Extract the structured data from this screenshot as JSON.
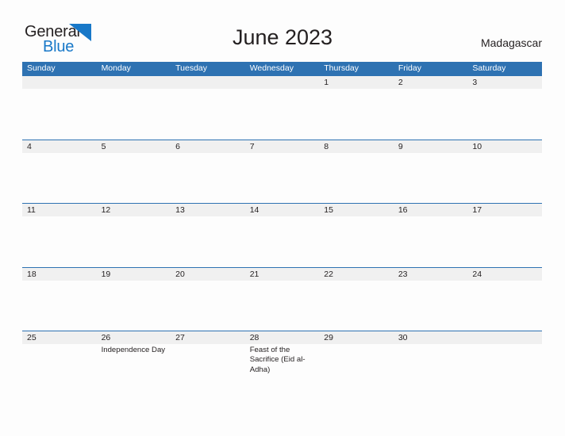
{
  "brand": {
    "name_part1": "General",
    "name_part2": "Blue",
    "flag_icon": "blue-flag-triangle-icon",
    "color_dark": "#231f20",
    "color_blue": "#1878c8"
  },
  "header": {
    "title": "June 2023",
    "region": "Madagascar"
  },
  "theme": {
    "header_blue": "#2e72b2",
    "row_band_gray": "#f0f0f0",
    "page_background": "#fdfdfd",
    "text_color": "#231f20"
  },
  "calendar": {
    "month": "June",
    "year": "2023",
    "weekdays": [
      "Sunday",
      "Monday",
      "Tuesday",
      "Wednesday",
      "Thursday",
      "Friday",
      "Saturday"
    ],
    "weeks": [
      {
        "days": [
          {
            "number": "",
            "events": []
          },
          {
            "number": "",
            "events": []
          },
          {
            "number": "",
            "events": []
          },
          {
            "number": "",
            "events": []
          },
          {
            "number": "1",
            "events": []
          },
          {
            "number": "2",
            "events": []
          },
          {
            "number": "3",
            "events": []
          }
        ]
      },
      {
        "days": [
          {
            "number": "4",
            "events": []
          },
          {
            "number": "5",
            "events": []
          },
          {
            "number": "6",
            "events": []
          },
          {
            "number": "7",
            "events": []
          },
          {
            "number": "8",
            "events": []
          },
          {
            "number": "9",
            "events": []
          },
          {
            "number": "10",
            "events": []
          }
        ]
      },
      {
        "days": [
          {
            "number": "11",
            "events": []
          },
          {
            "number": "12",
            "events": []
          },
          {
            "number": "13",
            "events": []
          },
          {
            "number": "14",
            "events": []
          },
          {
            "number": "15",
            "events": []
          },
          {
            "number": "16",
            "events": []
          },
          {
            "number": "17",
            "events": []
          }
        ]
      },
      {
        "days": [
          {
            "number": "18",
            "events": []
          },
          {
            "number": "19",
            "events": []
          },
          {
            "number": "20",
            "events": []
          },
          {
            "number": "21",
            "events": []
          },
          {
            "number": "22",
            "events": []
          },
          {
            "number": "23",
            "events": []
          },
          {
            "number": "24",
            "events": []
          }
        ]
      },
      {
        "days": [
          {
            "number": "25",
            "events": []
          },
          {
            "number": "26",
            "events": [
              "Independence Day"
            ]
          },
          {
            "number": "27",
            "events": []
          },
          {
            "number": "28",
            "events": [
              "Feast of the Sacrifice (Eid al-Adha)"
            ]
          },
          {
            "number": "29",
            "events": []
          },
          {
            "number": "30",
            "events": []
          },
          {
            "number": "",
            "events": []
          }
        ]
      }
    ]
  }
}
